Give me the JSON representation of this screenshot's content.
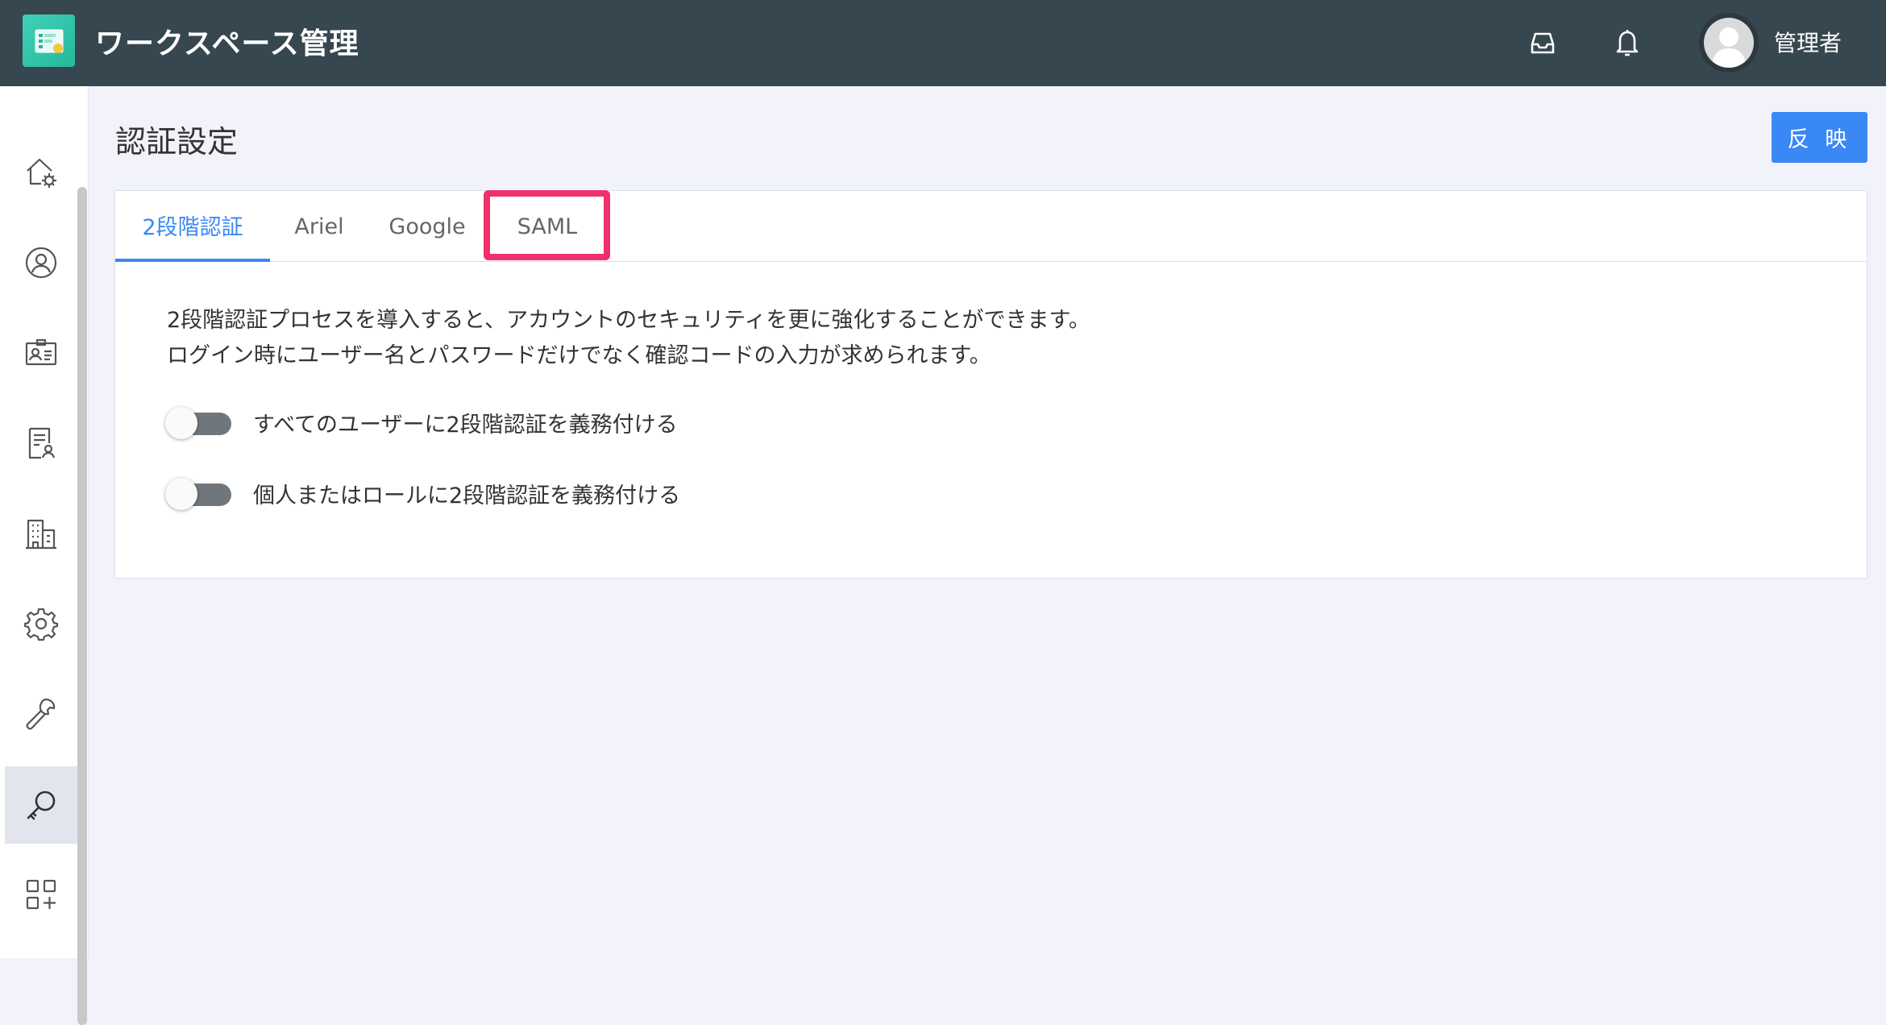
{
  "header": {
    "app_title": "ワークスペース管理",
    "user_name": "管理者",
    "icons": [
      "app-logo-icon",
      "inbox-icon",
      "bell-icon",
      "avatar"
    ]
  },
  "sidebar": {
    "items": [
      {
        "name": "home-settings",
        "icon": "home-gear-icon"
      },
      {
        "name": "users",
        "icon": "user-circle-icon"
      },
      {
        "name": "id-card",
        "icon": "id-card-icon"
      },
      {
        "name": "document-user",
        "icon": "document-user-icon"
      },
      {
        "name": "organization",
        "icon": "building-icon"
      },
      {
        "name": "settings",
        "icon": "gear-icon"
      },
      {
        "name": "tools",
        "icon": "wrench-icon"
      },
      {
        "name": "authentication",
        "icon": "key-icon",
        "active": true
      },
      {
        "name": "apps",
        "icon": "grid-plus-icon"
      }
    ]
  },
  "page": {
    "title": "認証設定",
    "apply_label": "反 映"
  },
  "tabs": [
    {
      "label": "2段階認証",
      "active": true
    },
    {
      "label": "Ariel"
    },
    {
      "label": "Google"
    },
    {
      "label": "SAML",
      "highlighted": true
    }
  ],
  "content": {
    "description_line1": "2段階認証プロセスを導入すると、アカウントのセキュリティを更に強化することができます。",
    "description_line2": "ログイン時にユーザー名とパスワードだけでなく確認コードの入力が求められます。",
    "toggles": [
      {
        "label": "すべてのユーザーに2段階認証を義務付ける",
        "on": false
      },
      {
        "label": "個人またはロールに2段階認証を義務付ける",
        "on": false
      }
    ]
  },
  "colors": {
    "header_bg": "#37474f",
    "accent": "#3a88f5",
    "highlight": "#f0306a",
    "page_bg": "#f1f2fa"
  }
}
